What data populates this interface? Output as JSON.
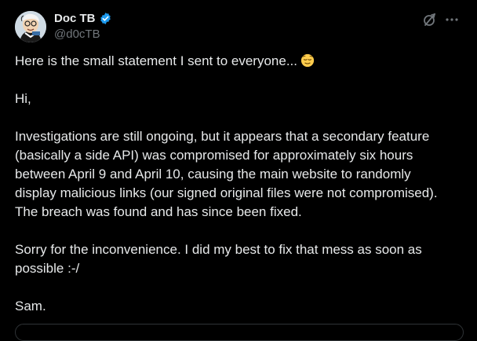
{
  "author": {
    "display_name": "Doc TB",
    "handle": "@d0cTB"
  },
  "post": {
    "intro": "Here is the small statement I sent to everyone...",
    "intro_emoji": "relieved-face-emoji",
    "greeting": "Hi,",
    "paragraph_1_lines": [
      "Investigations are still ongoing, but it appears that a secondary feature",
      "(basically a side API) was compromised for approximately six hours",
      "between April 9 and April 10, causing the main website to randomly",
      "display malicious links (our signed original files were not compromised).",
      "The breach was found and has since been fixed."
    ],
    "paragraph_2_lines": [
      "Sorry for the inconvenience. I did my best to fix that mess as soon as",
      "possible :-/"
    ],
    "signature": "Sam."
  },
  "icons": {
    "verified": "verified-badge-icon",
    "grok": "grok-icon",
    "more": "more-options-icon"
  },
  "colors": {
    "background": "#000000",
    "text": "#e7e9ea",
    "secondary_text": "#71767b",
    "verified_blue": "#1d9bf0",
    "border": "#2f3336"
  }
}
